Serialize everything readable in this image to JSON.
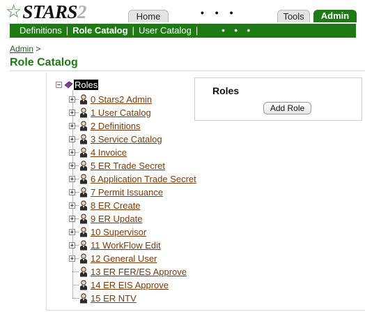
{
  "app": {
    "logo_text": "STARS",
    "logo_suffix": "2"
  },
  "top_tabs": {
    "home": "Home",
    "tools": "Tools",
    "admin": "Admin",
    "dots": "• • •"
  },
  "nav": {
    "items": [
      "Definitions",
      "Role Catalog",
      "User Catalog"
    ],
    "separator": "|",
    "dots": "• • •"
  },
  "breadcrumb": {
    "link": "Admin",
    "separator": ">"
  },
  "page_title": "Role Catalog",
  "tree": {
    "root_label": "Roles",
    "root_expander": "−",
    "items": [
      {
        "label": "0 Stars2 Admin",
        "expander": "+"
      },
      {
        "label": "1 User Catalog",
        "expander": "+"
      },
      {
        "label": "2 Definitions",
        "expander": "+"
      },
      {
        "label": "3 Service Catalog",
        "expander": "+"
      },
      {
        "label": "4 Invoice",
        "expander": "+"
      },
      {
        "label": "5 ER Trade Secret",
        "expander": "+"
      },
      {
        "label": "6 Application Trade Secret",
        "expander": "+"
      },
      {
        "label": "7 Permit Issuance",
        "expander": "+"
      },
      {
        "label": "8 ER Create",
        "expander": "+"
      },
      {
        "label": "9 ER Update",
        "expander": "+"
      },
      {
        "label": "10 Supervisor",
        "expander": "+"
      },
      {
        "label": "11 WorkFlow Edit",
        "expander": "+"
      },
      {
        "label": "12 General User",
        "expander": "+"
      },
      {
        "label": "13 ER FER/ES Approve",
        "expander": ""
      },
      {
        "label": "14 ER EIS Approve",
        "expander": ""
      },
      {
        "label": "15 ER NTV",
        "expander": ""
      }
    ]
  },
  "panel": {
    "title": "Roles",
    "button": "Add Role"
  },
  "colors": {
    "brand_green": "#1f7a16",
    "link_brown": "#7a3a0a"
  },
  "icons": {
    "root": "roles-book-icon",
    "item": "person-icon",
    "logo": "star-icon"
  }
}
